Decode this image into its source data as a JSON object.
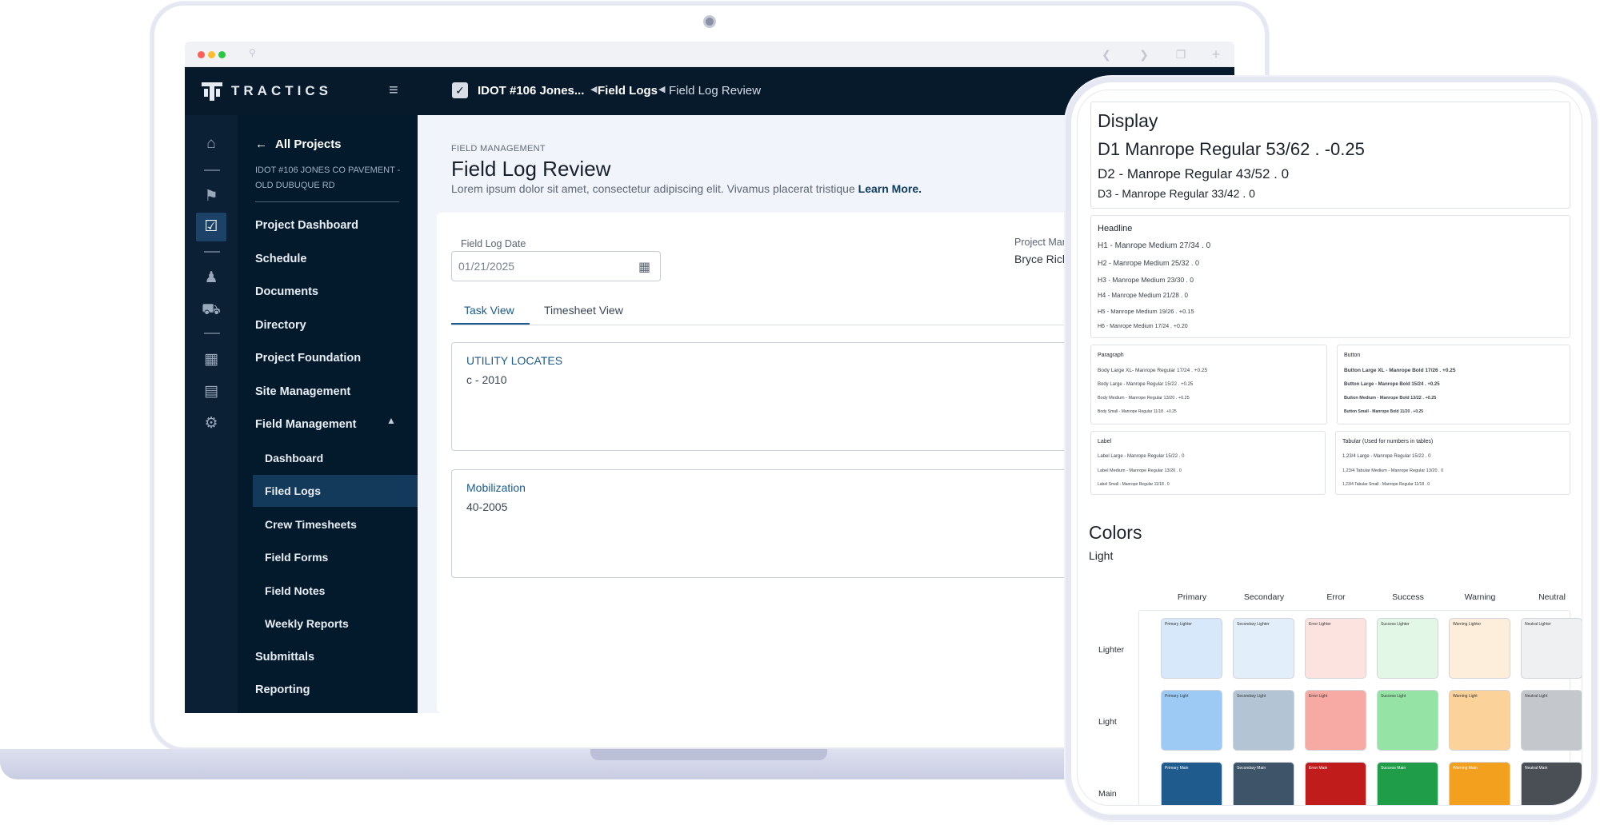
{
  "browser": {
    "traffic_lights": [
      "#ff5f57",
      "#febc2e",
      "#28c840"
    ]
  },
  "app": {
    "brand": "TRACTICS",
    "breadcrumb": [
      "IDOT #106 Jones...",
      "Field Logs",
      "Field Log Review"
    ],
    "back_label": "All Projects",
    "project_name": "IDOT #106 JONES CO PAVEMENT - OLD DUBUQUE RD",
    "nav": [
      "Project Dashboard",
      "Schedule",
      "Documents",
      "Directory",
      "Project Foundation",
      "Site Management",
      "Field Management"
    ],
    "sub_nav": [
      "Dashboard",
      "Filed Logs",
      "Crew Timesheets",
      "Field Forms",
      "Field Notes",
      "Weekly Reports"
    ],
    "nav_after": [
      "Submittals",
      "Reporting"
    ],
    "rail_icons": [
      "home-icon",
      "tag-icon",
      "checklist-icon",
      "people-icon",
      "truck-icon",
      "table-icon",
      "document-icon",
      "person-gear-icon"
    ]
  },
  "page": {
    "eyebrow": "FIELD MANAGEMENT",
    "title": "Field Log Review",
    "subtitle": "Lorem ipsum dolor sit amet, consectetur adipiscing elit. Vivamus placerat tristique",
    "learn_more": "Learn More.",
    "date_label": "Field Log Date",
    "date_value": "01/21/2025",
    "pm_label": "Project Manag",
    "pm_value": "Bryce Ricklef",
    "tabs": [
      "Task View",
      "Timesheet View"
    ],
    "tasks": [
      {
        "title": "UTILITY LOCATES",
        "code": "c - 2010"
      },
      {
        "title": "Mobilization",
        "code": "40-2005"
      }
    ]
  },
  "tablet": {
    "display": {
      "heading": "Display",
      "d1": "D1 Manrope Regular 53/62 . -0.25",
      "d2": "D2 - Manrope Regular 43/52 . 0",
      "d3": "D3 - Manrope Regular 33/42 . 0"
    },
    "headline": {
      "heading": "Headline",
      "items": [
        "H1 - Manrope Medium 27/34 . 0",
        "H2 - Manrope Medium 25/32 . 0",
        "H3 - Manrope Medium 23/30 . 0",
        "H4 - Manrope Medium 21/28 . 0",
        "H5 - Manrope Medium 19/26 . +0.15",
        "H6 - Manrope Medium 17/24 . +0.20"
      ]
    },
    "paragraph": {
      "heading": "Paragraph",
      "items": [
        "Body Large XL- Manrope Regular 17/24 . +0.25",
        "Body Large - Manrope Regular 15/22 . +0.25",
        "Body Medium - Manrope Regular 13/20 . +0.25",
        "Body Small - Manrope Regular 11/18 . +0.25"
      ]
    },
    "button": {
      "heading": "Button",
      "items": [
        "Button Large XL - Manrope Bold 17/26 . +0.25",
        "Button Large - Manrope Bold 15/24 . +0.25",
        "Button Medium - Manrope Bold 13/22 . +0.25",
        "Button Small - Manrope Bold 11/20 . +0.25"
      ]
    },
    "label": {
      "heading": "Label",
      "items": [
        "Label Large - Manrope Regular 15/22 . 0",
        "Label Medium - Manrope Regular 13/20 . 0",
        "Label Small - Manrope Regular 11/18 . 0"
      ]
    },
    "tabular": {
      "heading": "Tabular (Used for numbers in tables)",
      "items": [
        "1,23/4 Large - Manrope Regular 15/22 . 0",
        "1,23/4 Tabular Medium - Manrope Regular 13/20 . 0",
        "1,23/4 Tabular Small - Manrope Regular 11/18 . 0"
      ]
    },
    "colors": {
      "heading": "Colors",
      "sub": "Light",
      "columns": [
        "Primary",
        "Secondary",
        "Error",
        "Success",
        "Warning",
        "Neutral"
      ],
      "rows": [
        "Lighter",
        "Light",
        "Main"
      ],
      "swatches": [
        [
          "#d7e8fb",
          "#e3eefb",
          "#fde3e0",
          "#e2f7e6",
          "#fdeedb",
          "#eef0f2"
        ],
        [
          "#9ccaf5",
          "#b3c4d4",
          "#f7aaa3",
          "#96e3a6",
          "#fbd39a",
          "#c4c8cd"
        ],
        [
          "#1f5b8c",
          "#3e5468",
          "#c01c1c",
          "#1f9d48",
          "#f2a01d",
          "#4a4f55"
        ]
      ],
      "swatch_labels": [
        [
          "Primary Lighter",
          "Secondary Lighter",
          "Error Lighter",
          "Success Lighter",
          "Warning Lighter",
          "Neutral Lighter"
        ],
        [
          "Primary Light",
          "Secondary Light",
          "Error Light",
          "Success Light",
          "Warning Light",
          "Neutral Light"
        ],
        [
          "Primary Main",
          "Secondary Main",
          "Error Main",
          "Success Main",
          "Warning Main",
          "Neutral Main"
        ]
      ]
    }
  }
}
